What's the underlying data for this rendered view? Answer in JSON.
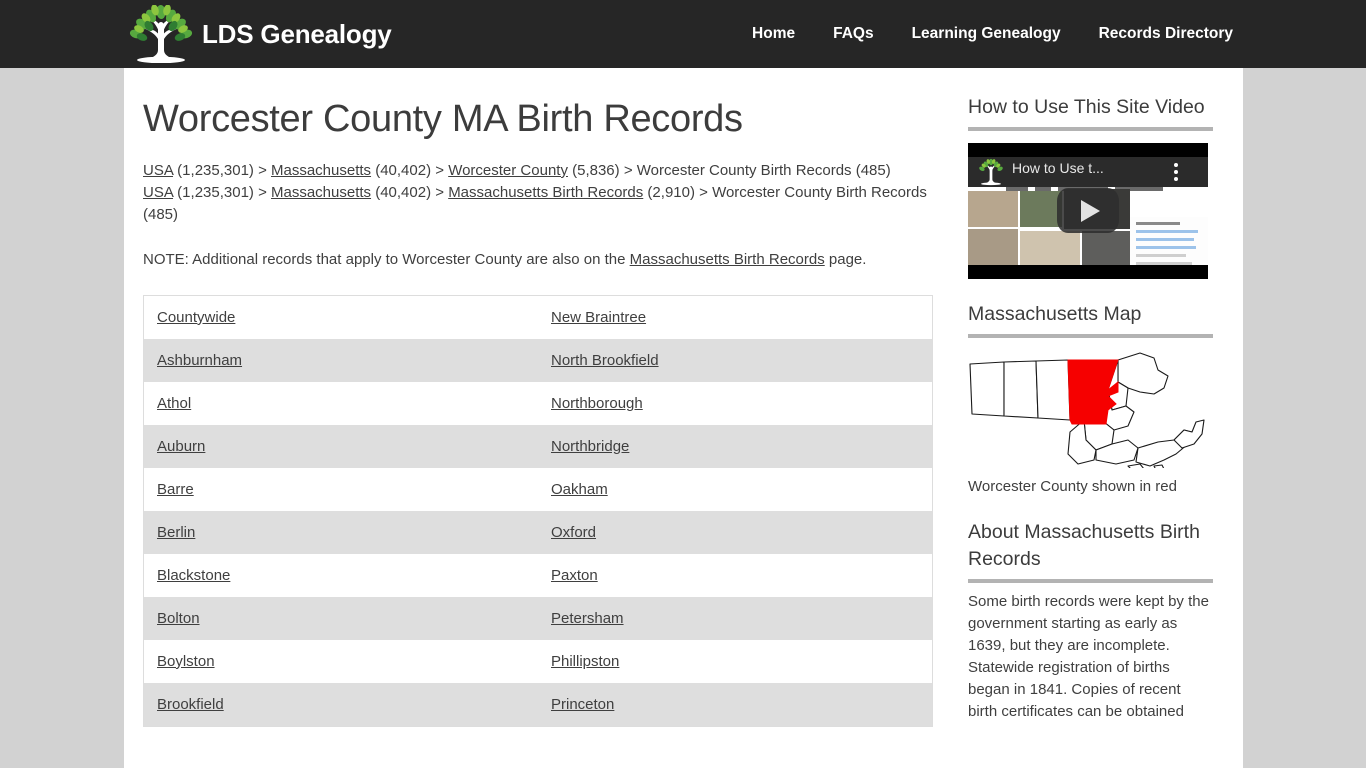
{
  "header": {
    "brand": "LDS Genealogy",
    "logo_icon": "tree-logo-icon",
    "nav": [
      {
        "label": "Home"
      },
      {
        "label": "FAQs"
      },
      {
        "label": "Learning Genealogy"
      },
      {
        "label": "Records Directory"
      }
    ]
  },
  "main": {
    "title": "Worcester County MA Birth Records",
    "breadcrumb1": {
      "usa": "USA",
      "usa_count": " (1,235,301) > ",
      "state": "Massachusetts",
      "state_count": " (40,402) > ",
      "county": "Worcester County",
      "county_count": " (5,836) > ",
      "current": "Worcester County Birth Records (485)"
    },
    "breadcrumb2": {
      "usa": "USA",
      "usa_count": " (1,235,301) > ",
      "state": "Massachusetts",
      "state_count": " (40,402) > ",
      "state_births": "Massachusetts Birth Records",
      "state_births_count": " (2,910) > ",
      "current": "Worcester County Birth Records (485)"
    },
    "note": {
      "before": "NOTE: Additional records that apply to Worcester County are also on the ",
      "link": "Massachusetts Birth Records",
      "after": " page."
    },
    "table_rows": [
      {
        "left": "Countywide",
        "right": "New Braintree"
      },
      {
        "left": "Ashburnham",
        "right": "North Brookfield"
      },
      {
        "left": "Athol",
        "right": "Northborough"
      },
      {
        "left": "Auburn",
        "right": "Northbridge"
      },
      {
        "left": "Barre",
        "right": "Oakham"
      },
      {
        "left": "Berlin",
        "right": "Oxford"
      },
      {
        "left": "Blackstone",
        "right": "Paxton"
      },
      {
        "left": "Bolton",
        "right": "Petersham"
      },
      {
        "left": "Boylston",
        "right": "Phillipston"
      },
      {
        "left": "Brookfield",
        "right": "Princeton"
      }
    ]
  },
  "sidebar": {
    "video": {
      "heading": "How to Use This Site Video",
      "player_title": "How to Use t...",
      "play_icon": "play-button-icon",
      "menu_icon": "kebab-menu-icon"
    },
    "map": {
      "heading": "Massachusetts Map",
      "caption": "Worcester County shown in red",
      "highlight_color": "#f60000"
    },
    "about": {
      "heading": "About Massachusetts Birth Records",
      "text": "Some birth records were kept by the government starting as early as 1639, but they are incomplete. Statewide registration of births began in 1841. Copies of recent birth certificates can be obtained"
    }
  },
  "theme": {
    "header_bg": "#262626",
    "page_bg": "#d2d2d2",
    "row_alt": "#dedede",
    "text": "#3f3f3f"
  }
}
